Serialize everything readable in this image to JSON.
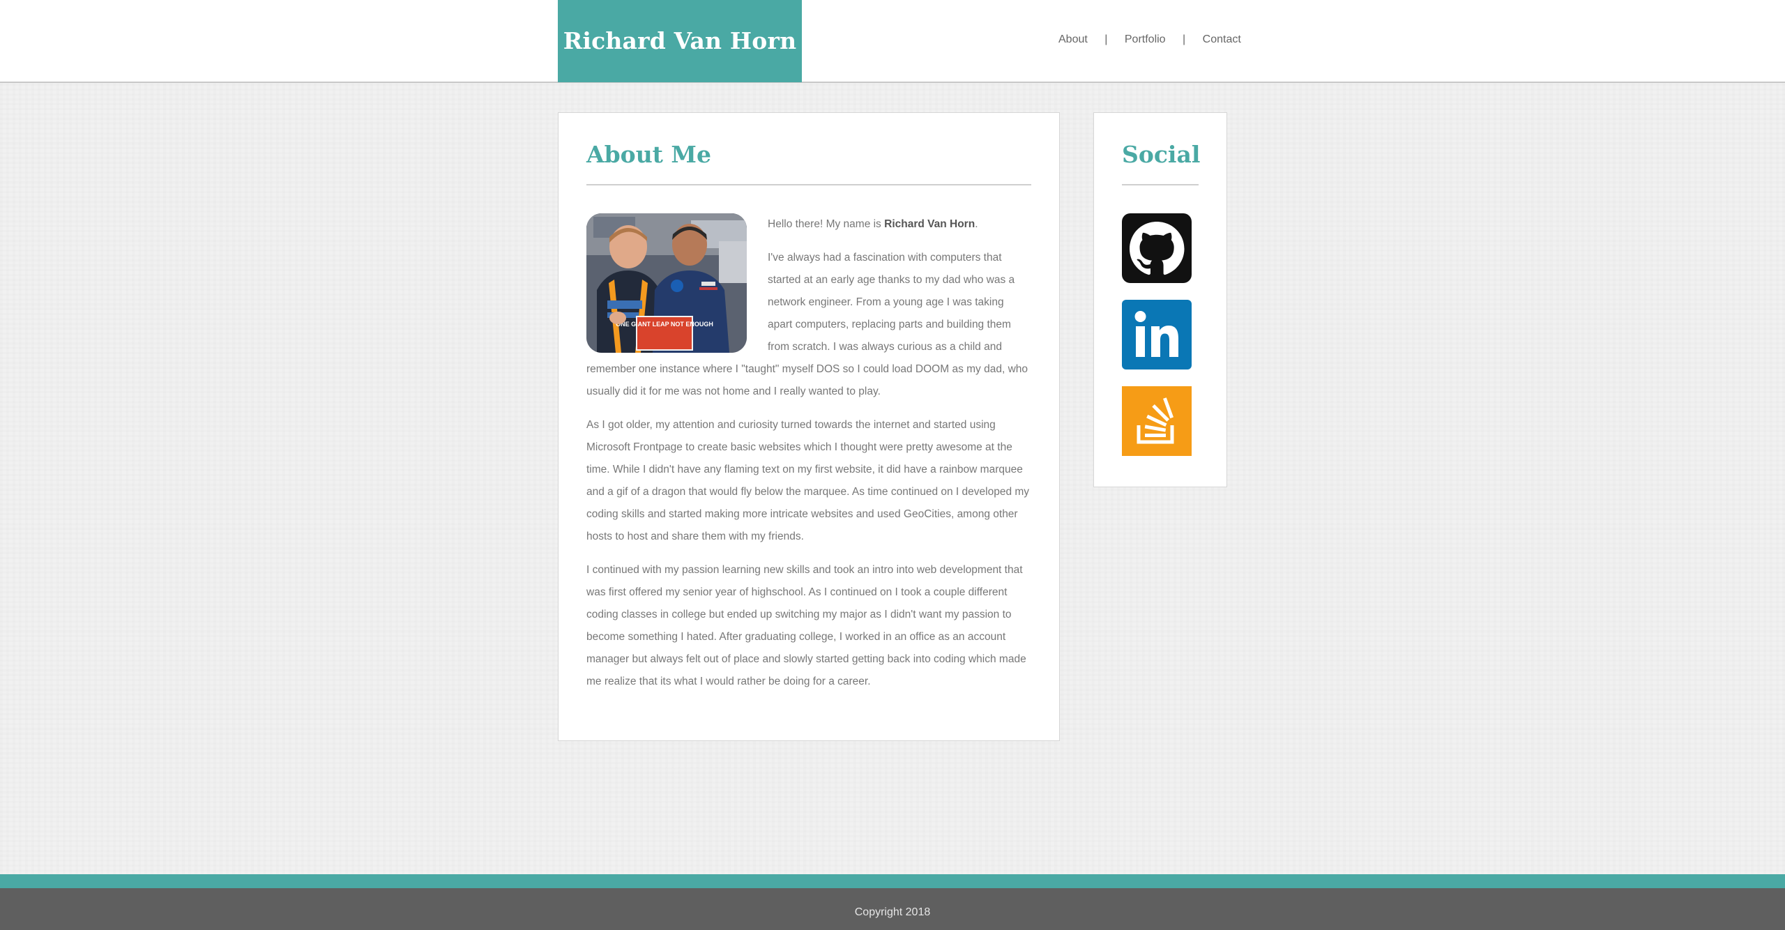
{
  "header": {
    "brand_title": "Richard Van Horn",
    "nav": [
      {
        "label": "About"
      },
      {
        "label": "Portfolio"
      },
      {
        "label": "Contact"
      }
    ],
    "separator": "|"
  },
  "about": {
    "title": "About Me",
    "intro_prefix": "Hello there! My name is ",
    "intro_name": "Richard Van Horn",
    "intro_suffix": ".",
    "para1": "I've always had a fascination with computers that started at an early age thanks to my dad who was a network engineer. From a young age I was taking apart computers, replacing parts and building them from scratch. I was always curious as a child and remember one instance where I \"taught\" myself DOS so I could load DOOM as my dad, who usually did it for me was not home and I really wanted to play.",
    "para2": "As I got older, my attention and curiosity turned towards the internet and started using Microsoft Frontpage to create basic websites which I thought were pretty awesome at the time. While I didn't have any flaming text on my first website, it did have a rainbow marquee and a gif of a dragon that would fly below the marquee. As time continued on I developed my coding skills and started making more intricate websites and used GeoCities, among other hosts to host and share them with my friends.",
    "para3": "I continued with my passion learning new skills and took an intro into web development that was first offered my senior year of highschool. As I continued on I took a couple different coding classes in college but ended up switching my major as I didn't want my passion to become something I hated. After graduating college, I worked in an office as an account manager but always felt out of place and slowly started getting back into coding which made me realize that its what I would rather be doing for a career.",
    "photo_sign_text": "ONE GIANT LEAP NOT ENOUGH"
  },
  "social": {
    "title": "Social",
    "icons": [
      {
        "name": "github-icon",
        "color": "#111111"
      },
      {
        "name": "linkedin-icon",
        "color": "#0a77b5"
      },
      {
        "name": "stackoverflow-icon",
        "color": "#f69c16"
      }
    ],
    "linkedin_glyph": "in"
  },
  "footer": {
    "copyright": "Copyright 2018"
  },
  "colors": {
    "accent": "#4aa9a4",
    "footer_bg": "#5f5f5f",
    "body_text": "#777777"
  }
}
